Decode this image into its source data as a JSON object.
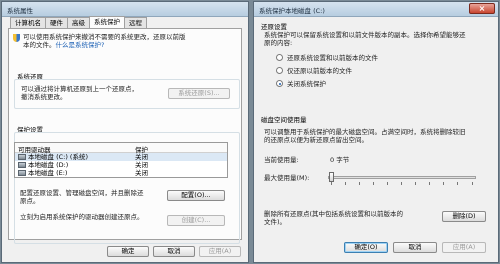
{
  "left_window": {
    "title": "系统属性",
    "tabs": [
      "计算机名",
      "硬件",
      "高级",
      "系统保护",
      "远程"
    ],
    "active_tab": 3,
    "intro_text_1": "可以使用系统保护来撤消不需要的系统更改，还原以前版",
    "intro_text_2": "本的文件。",
    "intro_link": "什么是系统保护?",
    "restore_section_title": "系统还原",
    "restore_text_1": "可以通过将计算机还原到上一个还原点，",
    "restore_text_2": "撤消系统更改。",
    "restore_button": "系统还原(S)...",
    "protection_section_title": "保护设置",
    "table_headers": [
      "可用驱动器",
      "保护"
    ],
    "table_rows": [
      {
        "drive": "本地磁盘 (C:) (系统)",
        "status": "关闭"
      },
      {
        "drive": "本地磁盘 (D:)",
        "status": "关闭"
      },
      {
        "drive": "本地磁盘 (E:)",
        "status": "关闭"
      }
    ],
    "configure_text_1": "配置还原设置、管理磁盘空间，并且删除还",
    "configure_text_2": "原点。",
    "configure_button": "配置(O)...",
    "create_text_1": "立刻为启用系统保护的驱动器创建还原点。",
    "create_text_2": "",
    "create_button": "创建(C)...",
    "ok": "确定",
    "cancel": "取消",
    "apply": "应用(A)"
  },
  "right_window": {
    "title": "系统保护本地磁盘 (C:)",
    "close_label": "×",
    "restore_settings_title": "还原设置",
    "restore_settings_text_1": "系统保护可以保留系统设置和以前文件版本的副本。选择你希望能够还",
    "restore_settings_text_2": "原的内容:",
    "options": [
      {
        "label": "还原系统设置和以前版本的文件",
        "checked": false
      },
      {
        "label": "仅还原以前版本的文件",
        "checked": false
      },
      {
        "label": "关闭系统保护",
        "checked": true
      }
    ],
    "disk_usage_title": "磁盘空间使用量",
    "disk_usage_text_1": "可以调整用于系统保护的最大磁盘空间。占满空间时，系统将删除较旧",
    "disk_usage_text_2": "的还原点以便为新还原点留出空间。",
    "current_usage_label": "当前使用量:",
    "current_usage_value": "0 字节",
    "max_usage_label": "最大使用量(M):",
    "max_usage_fraction": 0.0,
    "delete_text_1": "删除所有还原点(其中包括系统设置和以前版本的",
    "delete_text_2": "文件)。",
    "delete_button": "删除(D)",
    "ok": "确定(O)",
    "cancel": "取消",
    "apply": "应用(A)"
  }
}
